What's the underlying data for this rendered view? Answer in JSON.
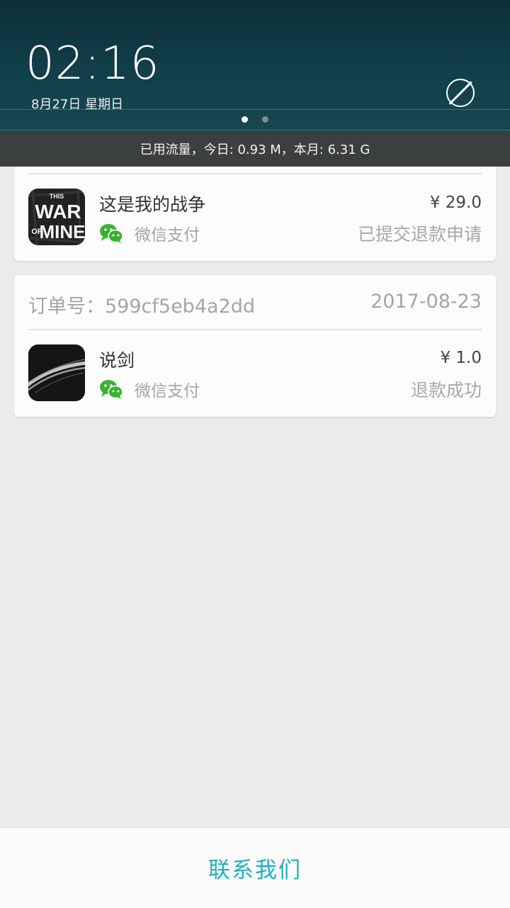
{
  "status_shade": {
    "time": "02:16",
    "date": "8月27日 星期日",
    "traffic": "已用流量，今日: 0.93 M，本月: 6.31 G"
  },
  "orders": [
    {
      "app_name": "这是我的战争",
      "app_icon_text": [
        "THIS",
        "WAR",
        "OF",
        "MINE"
      ],
      "payment": "微信支付",
      "price": "¥ 29.0",
      "status": "已提交退款申请"
    },
    {
      "order_label": "订单号：599cf5eb4a2dd",
      "order_date": "2017-08-23",
      "app_name": "说剑",
      "payment": "微信支付",
      "price": "¥ 1.0",
      "status": "退款成功"
    }
  ],
  "footer": {
    "contact_label": "联系我们"
  },
  "colors": {
    "accent": "#1fb0bd",
    "wechat_green": "#3cb034"
  }
}
